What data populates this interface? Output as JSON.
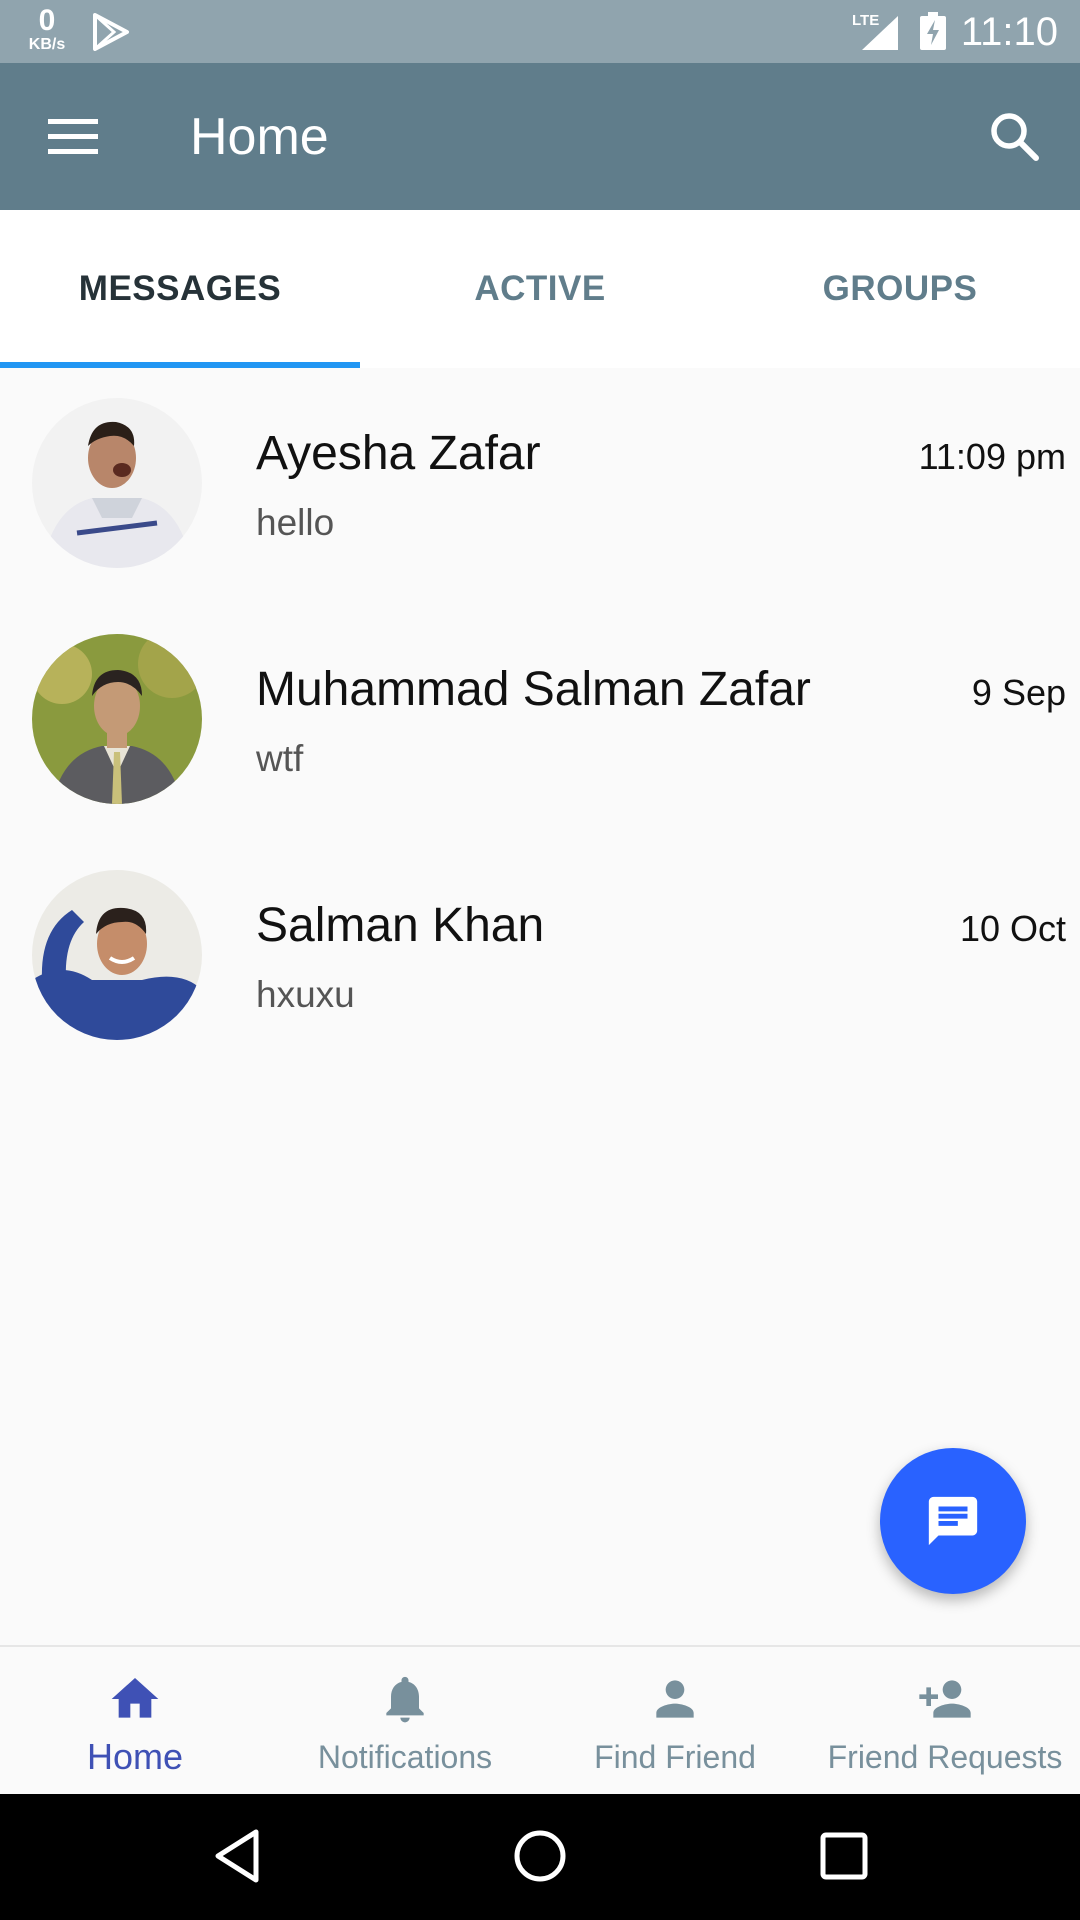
{
  "status_bar": {
    "speed_value": "0",
    "speed_unit": "KB/s",
    "network": "LTE",
    "time": "11:10"
  },
  "app_bar": {
    "title": "Home",
    "menu_icon": "menu-icon",
    "search_icon": "search-icon"
  },
  "tabs": [
    {
      "label": "MESSAGES",
      "active": true
    },
    {
      "label": "ACTIVE",
      "active": false
    },
    {
      "label": "GROUPS",
      "active": false
    }
  ],
  "chats": [
    {
      "name": "Ayesha Zafar",
      "message": "hello",
      "time": "11:09 pm"
    },
    {
      "name": "Muhammad Salman Zafar",
      "message": "wtf",
      "time": "9 Sep"
    },
    {
      "name": "Salman Khan",
      "message": "hxuxu",
      "time": "10 Oct"
    }
  ],
  "fab": {
    "icon": "message-icon"
  },
  "bottom_nav": [
    {
      "label": "Home",
      "icon": "home-icon",
      "active": true
    },
    {
      "label": "Notifications",
      "icon": "bell-icon",
      "active": false
    },
    {
      "label": "Find Friend",
      "icon": "person-icon",
      "active": false
    },
    {
      "label": "Friend Requests",
      "icon": "person-add-icon",
      "active": false
    }
  ],
  "colors": {
    "status_bar": "#90a4ae",
    "app_bar": "#607d8b",
    "tab_indicator": "#2196f3",
    "fab": "#2962ff",
    "nav_active": "#3f51b5",
    "nav_inactive": "#78909c"
  }
}
